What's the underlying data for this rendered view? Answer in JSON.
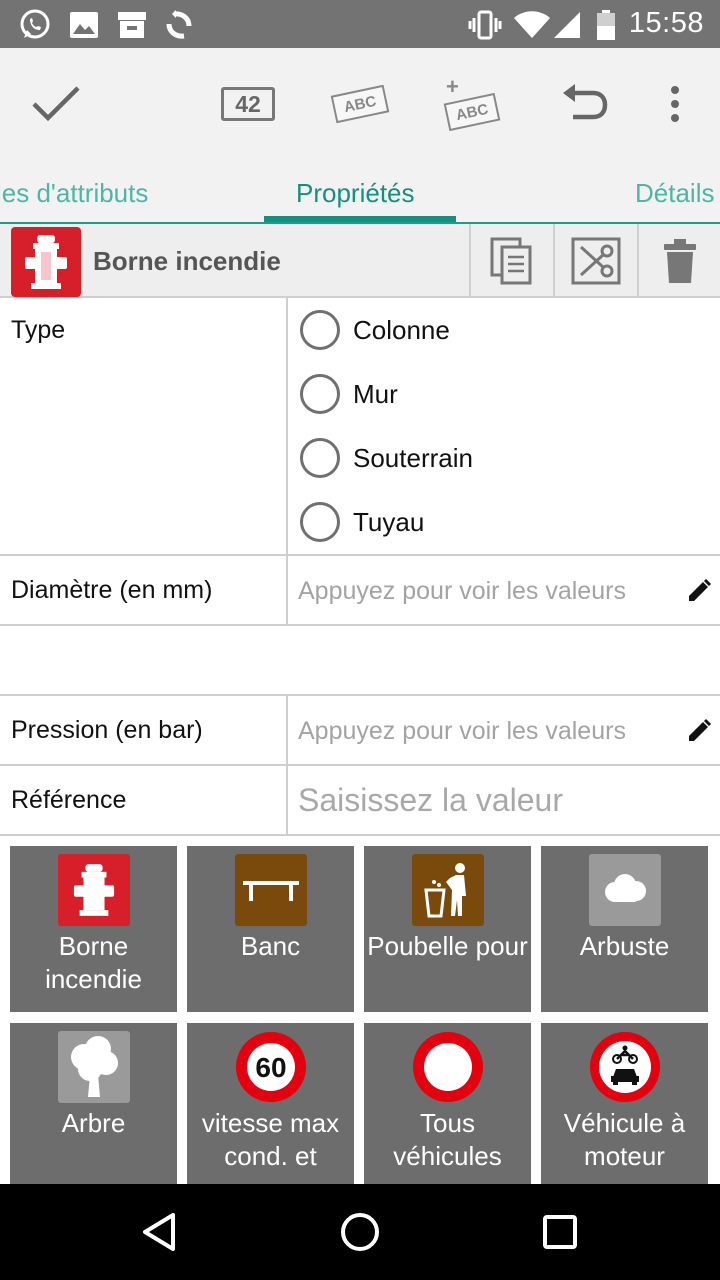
{
  "status_bar": {
    "time": "15:58",
    "left_icons": [
      "whatsapp-icon",
      "image-icon",
      "store-icon",
      "sync-icon"
    ],
    "right_icons": [
      "vibrate-icon",
      "wifi-icon",
      "signal-icon",
      "battery-icon"
    ]
  },
  "toolbar": {
    "confirm_icon": "check-icon",
    "count_badge": "42",
    "abc_label": "ABC",
    "add_abc_label": "ABC",
    "undo_icon": "undo-icon",
    "more_icon": "more-vert-icon"
  },
  "tabs": {
    "items": [
      {
        "label": "les d'attributs",
        "active": false
      },
      {
        "label": "Propriétés",
        "active": true
      },
      {
        "label": "Détails",
        "active": false
      }
    ]
  },
  "preset": {
    "name": "Borne incendie",
    "icon": "fire-hydrant-icon",
    "actions": [
      "copy-icon",
      "cut-icon",
      "delete-icon"
    ]
  },
  "form": {
    "type": {
      "label": "Type",
      "options": [
        "Colonne",
        "Mur",
        "Souterrain",
        "Tuyau"
      ]
    },
    "diametre": {
      "label": "Diamètre (en mm)",
      "hint": "Appuyez pour voir les valeurs"
    },
    "pression": {
      "label": "Pression (en bar)",
      "hint": "Appuyez pour voir les valeurs"
    },
    "reference": {
      "label": "Référence",
      "placeholder": "Saisissez la valeur"
    }
  },
  "preset_grid": {
    "tiles": [
      {
        "label": "Borne incendie",
        "icon": "fire-hydrant-icon"
      },
      {
        "label": "Banc",
        "icon": "bench-icon"
      },
      {
        "label": "Poubelle pour",
        "icon": "waste-basket-icon"
      },
      {
        "label": "Arbuste",
        "icon": "shrub-icon"
      },
      {
        "label": "Arbre",
        "icon": "tree-icon"
      },
      {
        "label": "vitesse max cond. et",
        "icon": "speed-limit-icon",
        "sign_value": "60"
      },
      {
        "label": "Tous véhicules",
        "icon": "no-vehicles-icon"
      },
      {
        "label": "Véhicule à moteur",
        "icon": "no-motor-vehicles-icon"
      }
    ]
  },
  "colors": {
    "accent": "#16907e",
    "hydrant_red": "#d71f2a",
    "tile_gray": "#6d6d6d",
    "bench_brown": "#7a4a0c"
  }
}
